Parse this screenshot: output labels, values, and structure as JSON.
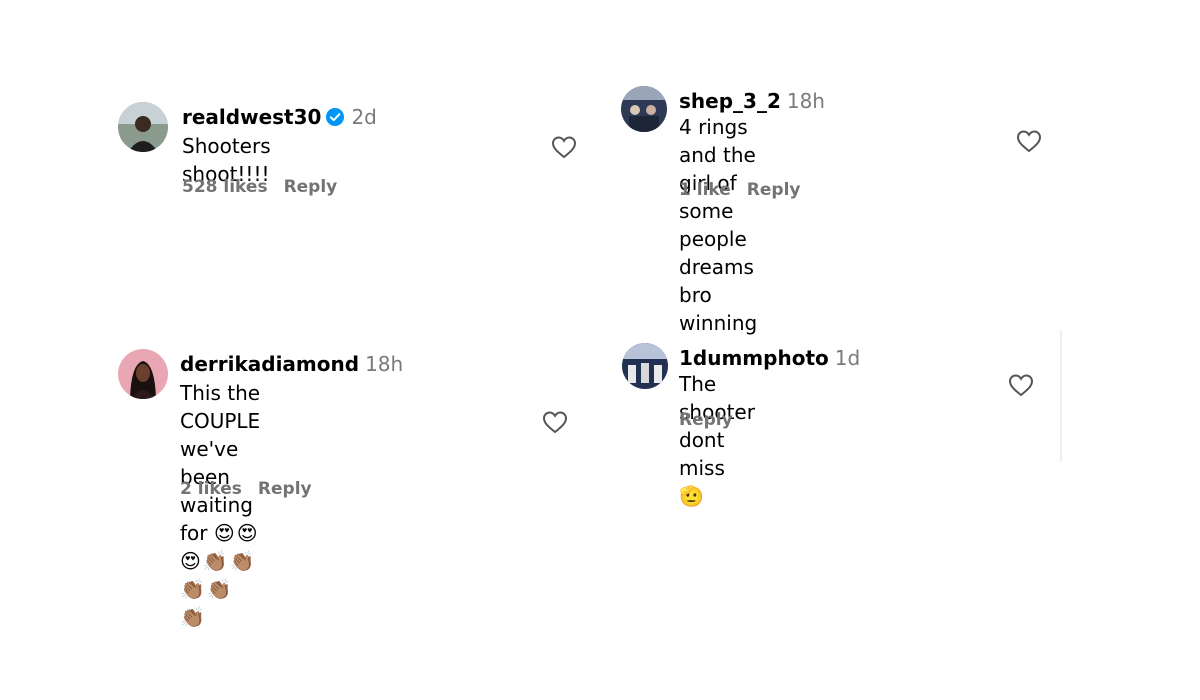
{
  "comments": [
    {
      "username": "realdwest30",
      "verified": true,
      "time": "2d",
      "text": "Shooters shoot!!!!",
      "emojis": "",
      "emojis_line2": "",
      "likes": "528 likes",
      "reply": "Reply"
    },
    {
      "username": "shep_3_2",
      "verified": false,
      "time": "18h",
      "text_line1": "4 rings and the girl of some people",
      "text_line2": "dreams bro winning",
      "likes": "1 like",
      "reply": "Reply"
    },
    {
      "username": "derrikadiamond",
      "verified": false,
      "time": "18h",
      "text_line1": "This the COUPLE we've been",
      "text_line2": "waiting for",
      "emojis": "😍😍😍👏🏽👏🏽👏🏽👏🏽",
      "emojis_line2": "👏🏽",
      "likes": "2 likes",
      "reply": "Reply"
    },
    {
      "username": "1dummphoto",
      "verified": false,
      "time": "1d",
      "text": "The shooter dont miss",
      "emojis": "🫡",
      "reply": "Reply"
    }
  ],
  "icons": {
    "heart": "heart-outline-icon",
    "verified": "verified-badge-icon"
  },
  "colors": {
    "verified": "#0095f6",
    "meta": "#737373",
    "time": "#7a7a7a"
  }
}
